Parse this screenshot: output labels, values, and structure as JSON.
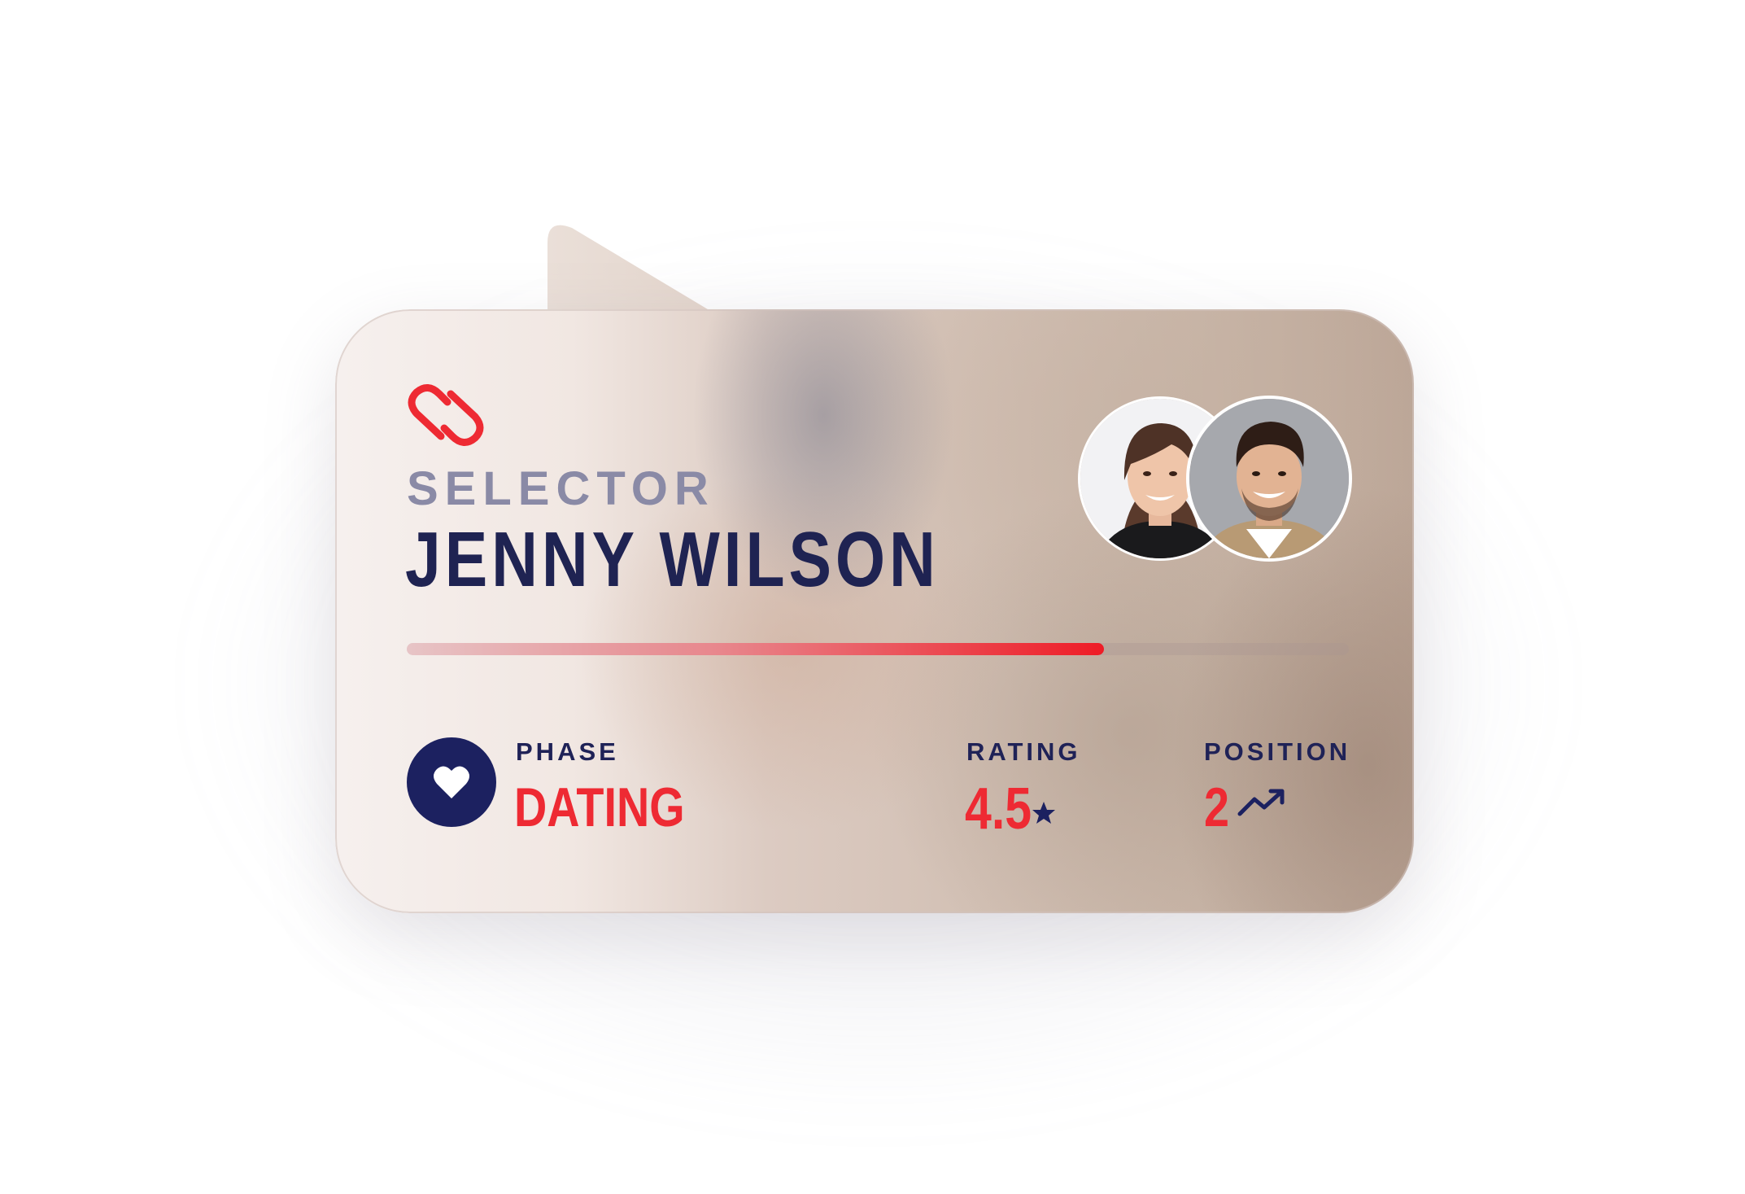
{
  "card": {
    "selector_label": "SELECTOR",
    "name": "JENNY WILSON",
    "progress": 0.74
  },
  "stats": {
    "phase": {
      "label": "PHASE",
      "value": "DATING"
    },
    "rating": {
      "label": "RATING",
      "value": "4.5"
    },
    "position": {
      "label": "POSITION",
      "value": "2"
    }
  },
  "colors": {
    "accent_red": "#ee2a33",
    "navy": "#1c2160",
    "muted_label": "#8a8aa6"
  },
  "icons": {
    "logo": "double-heart-logo",
    "phase": "heart-icon",
    "rating": "star-icon",
    "position": "trending-up-icon"
  }
}
